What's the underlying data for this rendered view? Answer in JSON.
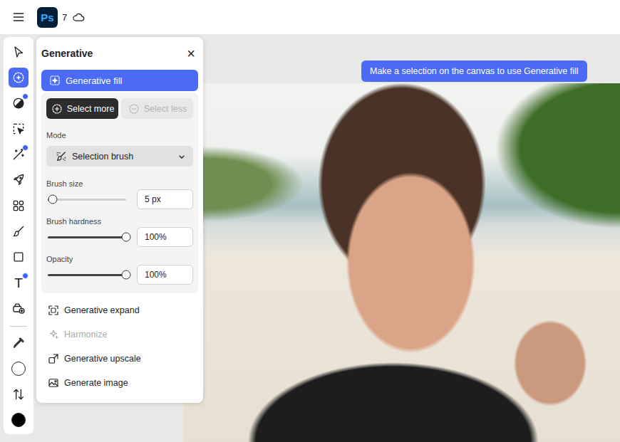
{
  "topbar": {
    "logo": "Ps",
    "count": "7"
  },
  "toolbar": {
    "tools": [
      {
        "selected": false,
        "badge": false,
        "glyph": ""
      },
      {
        "selected": true,
        "badge": false,
        "glyph": ""
      },
      {
        "selected": false,
        "badge": true,
        "glyph": ""
      },
      {
        "selected": false,
        "badge": false,
        "glyph": ""
      },
      {
        "selected": false,
        "badge": true,
        "glyph": ""
      },
      {
        "selected": false,
        "badge": false,
        "glyph": ""
      },
      {
        "selected": false,
        "badge": false,
        "glyph": ""
      },
      {
        "selected": false,
        "badge": false,
        "glyph": ""
      },
      {
        "selected": false,
        "badge": false,
        "glyph": ""
      },
      {
        "selected": false,
        "badge": true,
        "glyph": "T"
      },
      {
        "selected": false,
        "badge": false,
        "glyph": ""
      }
    ],
    "utility_tools": [
      {
        "selected": false,
        "badge": false,
        "glyph": ""
      }
    ],
    "swatches": [
      {
        "color": "#ffffff"
      },
      {
        "color": "#000000"
      }
    ]
  },
  "panel": {
    "title": "Generative",
    "close": "×",
    "feature": {
      "label": "Generative fill",
      "selected": true
    },
    "actions": [
      {
        "label": "Select more",
        "selected": true,
        "disabled": false
      },
      {
        "label": "Select less",
        "selected": false,
        "disabled": true
      }
    ],
    "mode": {
      "label": "Mode",
      "value": "Selection brush"
    },
    "sliders": [
      {
        "label": "Brush size",
        "level": 0.06,
        "value": "5 px"
      },
      {
        "label": "Brush hardness",
        "level": 1,
        "value": "100%"
      },
      {
        "label": "Opacity",
        "level": 1,
        "value": "100%"
      }
    ],
    "items": [
      {
        "label": "Generative expand",
        "disabled": false
      },
      {
        "label": "Harmonize",
        "disabled": true
      },
      {
        "label": "Generative upscale",
        "disabled": false
      },
      {
        "label": "Generate image",
        "disabled": false
      }
    ]
  },
  "canvas": {
    "hint": "Make a selection on the canvas to use Generative fill"
  }
}
